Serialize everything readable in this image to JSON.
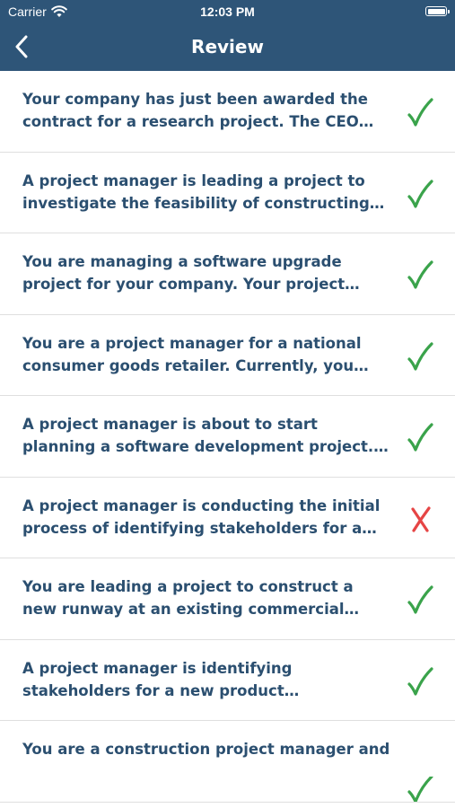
{
  "status_bar": {
    "carrier": "Carrier",
    "time": "12:03 PM",
    "battery_percent": 100
  },
  "nav": {
    "title": "Review"
  },
  "colors": {
    "header_bg": "#2e5578",
    "question_text": "#2b4f70",
    "correct": "#3aa34b",
    "incorrect": "#e64545"
  },
  "items": [
    {
      "text": "Your company has just been awarded the contract for a research project. The CEO of...",
      "result": "correct",
      "icon": "checkmark-icon"
    },
    {
      "text": "A project manager is leading a project to investigate the feasibility of constructing a...",
      "result": "correct",
      "icon": "checkmark-icon"
    },
    {
      "text": "You are managing a software upgrade project for your company. Your project sponsor ha...",
      "result": "correct",
      "icon": "checkmark-icon"
    },
    {
      "text": "You are a project manager for a national consumer goods retailer. Currently, you are...",
      "result": "correct",
      "icon": "checkmark-icon"
    },
    {
      "text": "A project manager is about to start planning a software development project. The project...",
      "result": "correct",
      "icon": "checkmark-icon"
    },
    {
      "text": "A project manager is conducting the initial process of identifying stakeholders for a n...",
      "result": "incorrect",
      "icon": "cross-icon"
    },
    {
      "text": "You are leading a project to construct a new runway at an existing commercial airport....",
      "result": "correct",
      "icon": "checkmark-icon"
    },
    {
      "text": "A project manager is identifying stakeholders for a new product development project. Wh...",
      "result": "correct",
      "icon": "checkmark-icon"
    },
    {
      "text": "You are a construction project manager and",
      "result": "correct",
      "icon": "checkmark-icon"
    }
  ]
}
